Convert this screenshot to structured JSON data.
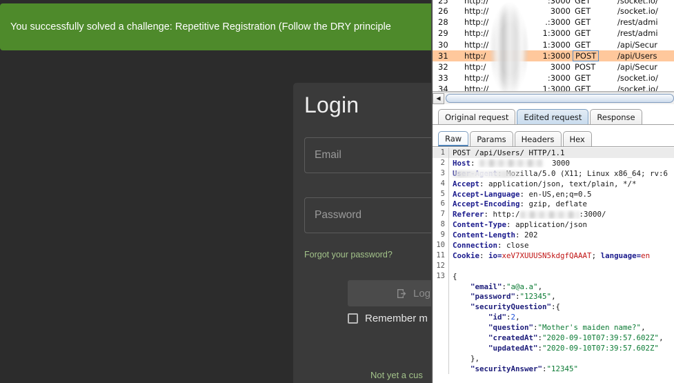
{
  "snackbar": {
    "message": "You successfully solved a challenge: Repetitive Registration (Follow the DRY principle",
    "background": "#4e8a2b",
    "text_color": "#ffffff"
  },
  "login": {
    "title": "Login",
    "email_placeholder": "Email",
    "password_placeholder": "Password",
    "forgot_label": "Forgot your password?",
    "login_button_label": "Log",
    "login_icon": "login-arrow-icon",
    "remember_label": "Remember m",
    "not_customer_label": "Not yet a cus",
    "link_color": "#a3c38a",
    "card_background": "#3a3a3a"
  },
  "burp": {
    "proxy_table": {
      "highlight_color": "#ffc89c",
      "rows": [
        {
          "num": "25",
          "proto": "http://",
          "port": ":3000",
          "method": "GET",
          "path": "/socket.io/",
          "selected": false,
          "partial": true
        },
        {
          "num": "26",
          "proto": "http://",
          "port": "3000",
          "method": "GET",
          "path": "/socket.io/",
          "selected": false,
          "partial": false
        },
        {
          "num": "28",
          "proto": "http://",
          "port": ".:3000",
          "method": "GET",
          "path": "/rest/admi",
          "selected": false,
          "partial": false
        },
        {
          "num": "29",
          "proto": "http://",
          "port": "1:3000",
          "method": "GET",
          "path": "/rest/admi",
          "selected": false,
          "partial": false
        },
        {
          "num": "30",
          "proto": "http://",
          "port": "1:3000",
          "method": "GET",
          "path": "/api/Secur",
          "selected": false,
          "partial": false
        },
        {
          "num": "31",
          "proto": "http:/",
          "port": "1:3000",
          "method": "POST",
          "path": "/api/Users",
          "selected": true,
          "partial": false
        },
        {
          "num": "32",
          "proto": "http:/",
          "port": "3000",
          "method": "POST",
          "path": "/api/Secur",
          "selected": false,
          "partial": false
        },
        {
          "num": "33",
          "proto": "http://",
          "port": ":3000",
          "method": "GET",
          "path": "/socket.io/",
          "selected": false,
          "partial": false
        },
        {
          "num": "34",
          "proto": "http://",
          "port": "1:3000",
          "method": "GET",
          "path": "/socket.io/",
          "selected": false,
          "partial": false
        }
      ]
    },
    "scrollbar": {
      "left_arrow": "◀"
    },
    "outer_tabs": [
      {
        "label": "Original request",
        "active": false
      },
      {
        "label": "Edited request",
        "active": true
      },
      {
        "label": "Response",
        "active": false
      }
    ],
    "inner_tabs": [
      {
        "label": "Raw",
        "active": true
      },
      {
        "label": "Params",
        "active": false
      },
      {
        "label": "Headers",
        "active": false
      },
      {
        "label": "Hex",
        "active": false
      }
    ],
    "request": {
      "line1_method_path": "POST /api/Users/ HTTP/1.1",
      "line2_key": "Host",
      "line2_value": "3000",
      "line3_key": "User-Agent",
      "line3_value": "Mozilla/5.0 (X11; Linux x86_64; rv:6",
      "line4_key": "Accept",
      "line4_value": "application/json, text/plain, */*",
      "line5_key": "Accept-Language",
      "line5_value": "en-US,en;q=0.5",
      "line6_key": "Accept-Encoding",
      "line6_value": "gzip, deflate",
      "line7_key": "Referer",
      "line7_value_pre": "http:/",
      "line7_value_post": ":3000/",
      "line8_key": "Content-Type",
      "line8_value": "application/json",
      "line9_key": "Content-Length",
      "line9_value": "202",
      "line10_key": "Connection",
      "line10_value": "close",
      "line11_key": "Cookie",
      "line11_value_a": "io=",
      "line11_value_b": "xeV7XUUUSN5kdgfQAAAT",
      "line11_sep": "; ",
      "line11_value_c": "language=",
      "line11_value_d": "en",
      "body_open": "{",
      "body": [
        {
          "key": "\"email\"",
          "sep": ":",
          "val": "\"a@a.a\"",
          "tail": ",",
          "type": "string",
          "indent": 1
        },
        {
          "key": "\"password\"",
          "sep": ":",
          "val": "\"12345\"",
          "tail": ",",
          "type": "string",
          "indent": 1
        },
        {
          "key": "\"securityQuestion\"",
          "sep": ":",
          "val": "{",
          "tail": "",
          "type": "plain",
          "indent": 1
        },
        {
          "key": "\"id\"",
          "sep": ":",
          "val": "2",
          "tail": ",",
          "type": "number",
          "indent": 2
        },
        {
          "key": "\"question\"",
          "sep": ":",
          "val": "\"Mother's maiden name?\"",
          "tail": ",",
          "type": "string",
          "indent": 2
        },
        {
          "key": "\"createdAt\"",
          "sep": ":",
          "val": "\"2020-09-10T07:39:57.602Z\"",
          "tail": ",",
          "type": "string",
          "indent": 2
        },
        {
          "key": "\"updatedAt\"",
          "sep": ":",
          "val": "\"2020-09-10T07:39:57.602Z\"",
          "tail": "",
          "type": "string",
          "indent": 2
        },
        {
          "key": "},",
          "sep": "",
          "val": "",
          "tail": "",
          "type": "plain",
          "indent": 1
        },
        {
          "key": "\"securityAnswer\"",
          "sep": ":",
          "val": "\"12345\"",
          "tail": "",
          "type": "string",
          "indent": 1
        }
      ],
      "line_numbers": [
        "1",
        "2",
        "3",
        "4",
        "5",
        "6",
        "7",
        "8",
        "9",
        "10",
        "11",
        "12",
        "13"
      ]
    }
  }
}
